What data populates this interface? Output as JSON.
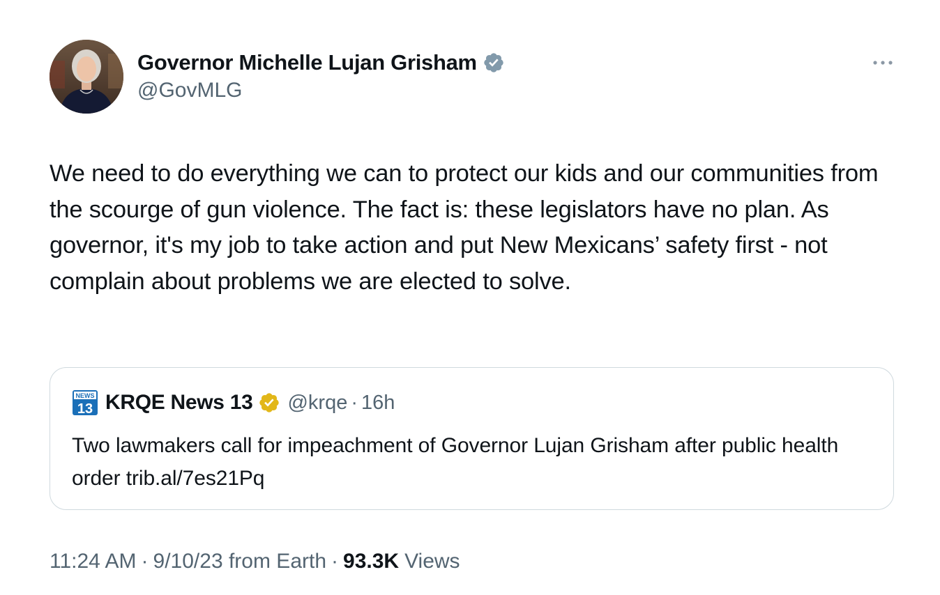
{
  "author": {
    "name": "Governor Michelle Lujan Grisham",
    "handle": "@GovMLG",
    "verified_color": "#829aab"
  },
  "more_icon": "ellipsis-icon",
  "tweet": {
    "text": "We need to do everything we can to protect our kids and our communities from the scourge of gun violence. The fact is: these legislators have no plan. As governor, it's my job to take action and put New Mexicans’ safety first - not complain about problems we are elected to solve."
  },
  "quote": {
    "logo_icon": "krqe-news13-logo",
    "name": "KRQE News 13",
    "handle": "@krqe",
    "separator": "·",
    "time": "16h",
    "verified_color": "#e2b719",
    "text": "Two lawmakers call for impeachment of Governor Lujan Grisham after public health order trib.al/7es21Pq"
  },
  "meta": {
    "time": "11:24 AM",
    "date": "9/10/23",
    "source": "from Earth",
    "separator": "·",
    "views_count": "93.3K",
    "views_label": "Views"
  },
  "colors": {
    "text_primary": "#0f1419",
    "text_secondary": "#536471",
    "border": "#cfd9de"
  }
}
